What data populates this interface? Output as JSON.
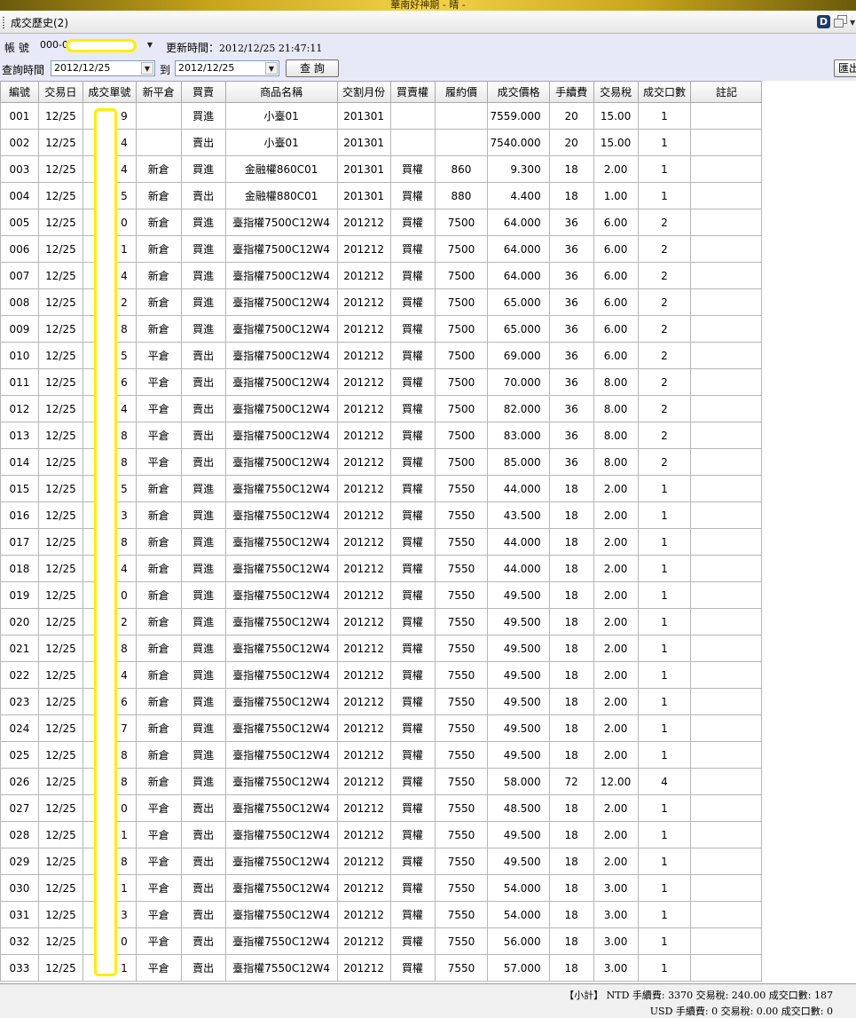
{
  "window": {
    "title": "華南好神期 - 晴 -"
  },
  "tab": {
    "title": "成交歷史(2)",
    "d_button": "D"
  },
  "filter": {
    "account_label": "帳  號",
    "account_value": "000-0",
    "update_label": "更新時間：",
    "update_time": "2012/12/25 21:47:11",
    "query_time_label": "查詢時間",
    "date_from": "2012/12/25",
    "to_label": "到",
    "date_to": "2012/12/25",
    "query_button": "查 詢",
    "export_button": "匯出"
  },
  "columns": [
    "編號",
    "交易日",
    "成交單號",
    "新平倉",
    "買賣",
    "商品名稱",
    "交割月份",
    "買賣權",
    "履約價",
    "成交價格",
    "手續費",
    "交易稅",
    "成交口數",
    "註記"
  ],
  "rows": [
    [
      "001",
      "12/25",
      "9",
      "",
      "買進",
      "小臺01",
      "201301",
      "",
      "",
      "7559.000",
      "20",
      "15.00",
      "1",
      ""
    ],
    [
      "002",
      "12/25",
      "4",
      "",
      "賣出",
      "小臺01",
      "201301",
      "",
      "",
      "7540.000",
      "20",
      "15.00",
      "1",
      ""
    ],
    [
      "003",
      "12/25",
      "4",
      "新倉",
      "買進",
      "金融權860C01",
      "201301",
      "買權",
      "860",
      "9.300",
      "18",
      "2.00",
      "1",
      ""
    ],
    [
      "004",
      "12/25",
      "5",
      "新倉",
      "賣出",
      "金融權880C01",
      "201301",
      "買權",
      "880",
      "4.400",
      "18",
      "1.00",
      "1",
      ""
    ],
    [
      "005",
      "12/25",
      "0",
      "新倉",
      "買進",
      "臺指權7500C12W4",
      "201212",
      "買權",
      "7500",
      "64.000",
      "36",
      "6.00",
      "2",
      ""
    ],
    [
      "006",
      "12/25",
      "1",
      "新倉",
      "買進",
      "臺指權7500C12W4",
      "201212",
      "買權",
      "7500",
      "64.000",
      "36",
      "6.00",
      "2",
      ""
    ],
    [
      "007",
      "12/25",
      "4",
      "新倉",
      "買進",
      "臺指權7500C12W4",
      "201212",
      "買權",
      "7500",
      "64.000",
      "36",
      "6.00",
      "2",
      ""
    ],
    [
      "008",
      "12/25",
      "2",
      "新倉",
      "買進",
      "臺指權7500C12W4",
      "201212",
      "買權",
      "7500",
      "65.000",
      "36",
      "6.00",
      "2",
      ""
    ],
    [
      "009",
      "12/25",
      "8",
      "新倉",
      "買進",
      "臺指權7500C12W4",
      "201212",
      "買權",
      "7500",
      "65.000",
      "36",
      "6.00",
      "2",
      ""
    ],
    [
      "010",
      "12/25",
      "5",
      "平倉",
      "賣出",
      "臺指權7500C12W4",
      "201212",
      "買權",
      "7500",
      "69.000",
      "36",
      "6.00",
      "2",
      ""
    ],
    [
      "011",
      "12/25",
      "6",
      "平倉",
      "賣出",
      "臺指權7500C12W4",
      "201212",
      "買權",
      "7500",
      "70.000",
      "36",
      "8.00",
      "2",
      ""
    ],
    [
      "012",
      "12/25",
      "4",
      "平倉",
      "賣出",
      "臺指權7500C12W4",
      "201212",
      "買權",
      "7500",
      "82.000",
      "36",
      "8.00",
      "2",
      ""
    ],
    [
      "013",
      "12/25",
      "8",
      "平倉",
      "賣出",
      "臺指權7500C12W4",
      "201212",
      "買權",
      "7500",
      "83.000",
      "36",
      "8.00",
      "2",
      ""
    ],
    [
      "014",
      "12/25",
      "8",
      "平倉",
      "賣出",
      "臺指權7500C12W4",
      "201212",
      "買權",
      "7500",
      "85.000",
      "36",
      "8.00",
      "2",
      ""
    ],
    [
      "015",
      "12/25",
      "5",
      "新倉",
      "買進",
      "臺指權7550C12W4",
      "201212",
      "買權",
      "7550",
      "44.000",
      "18",
      "2.00",
      "1",
      ""
    ],
    [
      "016",
      "12/25",
      "3",
      "新倉",
      "買進",
      "臺指權7550C12W4",
      "201212",
      "買權",
      "7550",
      "43.500",
      "18",
      "2.00",
      "1",
      ""
    ],
    [
      "017",
      "12/25",
      "8",
      "新倉",
      "買進",
      "臺指權7550C12W4",
      "201212",
      "買權",
      "7550",
      "44.000",
      "18",
      "2.00",
      "1",
      ""
    ],
    [
      "018",
      "12/25",
      "4",
      "新倉",
      "買進",
      "臺指權7550C12W4",
      "201212",
      "買權",
      "7550",
      "44.000",
      "18",
      "2.00",
      "1",
      ""
    ],
    [
      "019",
      "12/25",
      "0",
      "新倉",
      "買進",
      "臺指權7550C12W4",
      "201212",
      "買權",
      "7550",
      "49.500",
      "18",
      "2.00",
      "1",
      ""
    ],
    [
      "020",
      "12/25",
      "2",
      "新倉",
      "買進",
      "臺指權7550C12W4",
      "201212",
      "買權",
      "7550",
      "49.500",
      "18",
      "2.00",
      "1",
      ""
    ],
    [
      "021",
      "12/25",
      "8",
      "新倉",
      "買進",
      "臺指權7550C12W4",
      "201212",
      "買權",
      "7550",
      "49.500",
      "18",
      "2.00",
      "1",
      ""
    ],
    [
      "022",
      "12/25",
      "4",
      "新倉",
      "買進",
      "臺指權7550C12W4",
      "201212",
      "買權",
      "7550",
      "49.500",
      "18",
      "2.00",
      "1",
      ""
    ],
    [
      "023",
      "12/25",
      "6",
      "新倉",
      "買進",
      "臺指權7550C12W4",
      "201212",
      "買權",
      "7550",
      "49.500",
      "18",
      "2.00",
      "1",
      ""
    ],
    [
      "024",
      "12/25",
      "7",
      "新倉",
      "買進",
      "臺指權7550C12W4",
      "201212",
      "買權",
      "7550",
      "49.500",
      "18",
      "2.00",
      "1",
      ""
    ],
    [
      "025",
      "12/25",
      "8",
      "新倉",
      "買進",
      "臺指權7550C12W4",
      "201212",
      "買權",
      "7550",
      "49.500",
      "18",
      "2.00",
      "1",
      ""
    ],
    [
      "026",
      "12/25",
      "8",
      "新倉",
      "買進",
      "臺指權7550C12W4",
      "201212",
      "買權",
      "7550",
      "58.000",
      "72",
      "12.00",
      "4",
      ""
    ],
    [
      "027",
      "12/25",
      "0",
      "平倉",
      "賣出",
      "臺指權7550C12W4",
      "201212",
      "買權",
      "7550",
      "48.500",
      "18",
      "2.00",
      "1",
      ""
    ],
    [
      "028",
      "12/25",
      "1",
      "平倉",
      "賣出",
      "臺指權7550C12W4",
      "201212",
      "買權",
      "7550",
      "49.500",
      "18",
      "2.00",
      "1",
      ""
    ],
    [
      "029",
      "12/25",
      "8",
      "平倉",
      "賣出",
      "臺指權7550C12W4",
      "201212",
      "買權",
      "7550",
      "49.500",
      "18",
      "2.00",
      "1",
      ""
    ],
    [
      "030",
      "12/25",
      "1",
      "平倉",
      "賣出",
      "臺指權7550C12W4",
      "201212",
      "買權",
      "7550",
      "54.000",
      "18",
      "3.00",
      "1",
      ""
    ],
    [
      "031",
      "12/25",
      "3",
      "平倉",
      "賣出",
      "臺指權7550C12W4",
      "201212",
      "買權",
      "7550",
      "54.000",
      "18",
      "3.00",
      "1",
      ""
    ],
    [
      "032",
      "12/25",
      "0",
      "平倉",
      "賣出",
      "臺指權7550C12W4",
      "201212",
      "買權",
      "7550",
      "56.000",
      "18",
      "3.00",
      "1",
      ""
    ],
    [
      "033",
      "12/25",
      "1",
      "平倉",
      "賣出",
      "臺指權7550C12W4",
      "201212",
      "買權",
      "7550",
      "57.000",
      "18",
      "3.00",
      "1",
      ""
    ]
  ],
  "summary": {
    "line1": "【小計】   NTD 手續費: 3370    交易稅: 240.00    成交口數: 187",
    "line2": "USD 手續費: 0    交易稅: 0.00    成交口數: 0"
  },
  "colors": {
    "filter_bg": "#e8e9f6",
    "mask_yellow": "#ffee00"
  },
  "icons": {
    "d": "d-logo-icon",
    "window": "window-restore-icon",
    "dropdown": "chevron-down-icon"
  }
}
